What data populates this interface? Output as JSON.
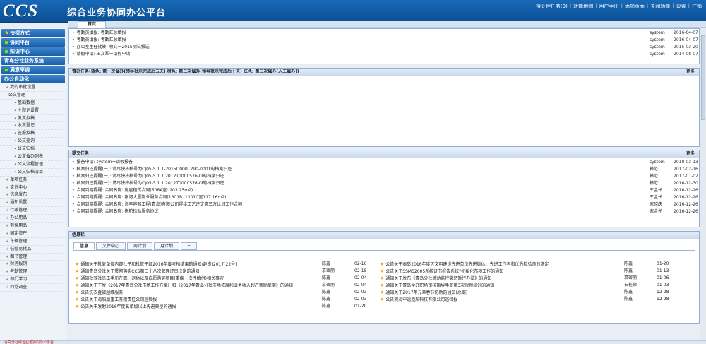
{
  "header": {
    "logo": "CCS",
    "title": "综合业务协同办公平台",
    "links": [
      "待处理任务(9)",
      "功能地图",
      "用户手册",
      "添加页面",
      "关闭功能",
      "设置",
      "注销"
    ]
  },
  "tabs": {
    "home": "首页"
  },
  "sidebar": {
    "sections_top": [
      "快捷方式",
      "协同平台",
      "知识中心",
      "青岛分社业务系统",
      "满意率调"
    ],
    "office_title": "办公自动化",
    "items": [
      {
        "label": "我的审批设置",
        "level": 0,
        "marker": "+"
      },
      {
        "label": "公文管理",
        "level": 0,
        "marker": "-"
      },
      {
        "label": "基础数据",
        "level": 1,
        "marker": "•"
      },
      {
        "label": "主题词设置",
        "level": 1,
        "marker": "•"
      },
      {
        "label": "发文拟稿",
        "level": 1,
        "marker": "•"
      },
      {
        "label": "收文登记",
        "level": 1,
        "marker": "•"
      },
      {
        "label": "签报拟稿",
        "level": 1,
        "marker": "•"
      },
      {
        "label": "公文查询",
        "level": 1,
        "marker": "•"
      },
      {
        "label": "公文归档",
        "level": 1,
        "marker": "•"
      },
      {
        "label": "公文催办列表",
        "level": 1,
        "marker": "•"
      },
      {
        "label": "公文流程管理",
        "level": 1,
        "marker": "•"
      },
      {
        "label": "公文归档清单",
        "level": 1,
        "marker": "•"
      },
      {
        "label": "单项任务",
        "level": 0,
        "marker": "+"
      },
      {
        "label": "文件中心",
        "level": 0,
        "marker": "+"
      },
      {
        "label": "信息发布",
        "level": 0,
        "marker": "+"
      },
      {
        "label": "通知设置",
        "level": 0,
        "marker": "+"
      },
      {
        "label": "行政管理",
        "level": 0,
        "marker": "+"
      },
      {
        "label": "办公用品",
        "level": 0,
        "marker": "+"
      },
      {
        "label": "劳保用品",
        "level": 0,
        "marker": "+"
      },
      {
        "label": "固定资产",
        "level": 0,
        "marker": "+"
      },
      {
        "label": "车辆管理",
        "level": 0,
        "marker": "+"
      },
      {
        "label": "低值易耗品",
        "level": 0,
        "marker": "+"
      },
      {
        "label": "图书管理",
        "level": 0,
        "marker": "+"
      },
      {
        "label": "财务报销",
        "level": 0,
        "marker": "+"
      },
      {
        "label": "考勤管理",
        "level": 0,
        "marker": "+"
      },
      {
        "label": "部门学习",
        "level": 0,
        "marker": "+"
      },
      {
        "label": "问卷调查",
        "level": 0,
        "marker": "+"
      }
    ]
  },
  "top_list": {
    "rows": [
      {
        "text": "考勤员填报: 考勤汇总填报",
        "who": "system",
        "when": "2016-04-07"
      },
      {
        "text": "考勤员填报: 考勤汇总填报",
        "who": "system",
        "when": "2016-04-07"
      },
      {
        "text": "办公室主任批转: 收文一2015测试报送",
        "who": "system",
        "when": "2015-03-20"
      },
      {
        "text": "请假申请: 王文军一请假申请",
        "who": "system",
        "when": "2014-08-07"
      }
    ]
  },
  "supervise": {
    "title": "督办任务(蓝色: 第一次催办(领导批示完成后五天) 橙色: 第二次催办(领导批示完成后十天) 红色: 第三次催办(人工催办))",
    "more": "更多"
  },
  "todo": {
    "title": "提交任务",
    "more": "更多",
    "rows": [
      {
        "text": "报备申请: system一请假报备",
        "who": "system",
        "when": "2018-03-13"
      },
      {
        "text": "档案归还提醒(一): 请尽快将档号为CJ05-5.1.1-2015D0001290-0001的档案归还",
        "who": "韩范",
        "when": "2017-02-16"
      },
      {
        "text": "档案归还提醒(一): 请尽快将档号为CJ05-5.1.1.2012T0000576-0l的档案归还",
        "who": "韩范",
        "when": "2017-01-02"
      },
      {
        "text": "档案归还提醒(一): 请尽快将档号为CJ05-5.1.1.2012T0000576-0l的档案归还",
        "who": "韩范",
        "when": "2016-12-30"
      },
      {
        "text": "合同到期提醒: 合同名称: 房屋租赁合同(506A室: 203.25m2)",
        "who": "王金长",
        "when": "2016-12-26"
      },
      {
        "text": "合同到期提醒: 合同名称: 银河大厦物业服务合同(1301B, 1301C室117.16m2)",
        "who": "王金长",
        "when": "2016-12-26"
      },
      {
        "text": "合同到期提醒: 合同名称: 海丰容器工程(青岛)有限公司焊接工艺评定第三方认证工作合同",
        "who": "宋晓庆",
        "when": "2016-12-26"
      },
      {
        "text": "合同到期提醒: 合同名称: 拖航检验服务协议",
        "who": "宋金光",
        "when": "2016-12-26"
      }
    ]
  },
  "info": {
    "title": "信息栏",
    "tabs": [
      "信息",
      "文件中心",
      "周计划",
      "月计划",
      "+"
    ],
    "left": [
      {
        "text": "通知关于批复单位内部社子和社管干部2016年度考核结果的通知/赵资(2017)22号)",
        "who": "陈鑫",
        "when": "02-16"
      },
      {
        "text": "通知青岛分社关于贯彻落实CCS第三十八次管理评审决定的通知",
        "who": "慕密丽",
        "when": "02-15"
      },
      {
        "text": "通知批驳社员工手册在职、退休以及自愿购买项目(重疾一次性给付)相关事宜",
        "who": "陈鑫",
        "when": "02-04"
      },
      {
        "text": "通知关于下发《2017年青岛分社市场工作方案》和《2017年青岛分社市场拓展和业务收入超产奖励草案》的通知",
        "who": "慕密丽",
        "when": "02-04"
      },
      {
        "text": "公告洗衣叠被超级服务",
        "who": "陈鑫",
        "when": "02-03"
      },
      {
        "text": "公告关于海船舶重工有限责任公司巡检报",
        "who": "陈鑫",
        "when": "02-03"
      },
      {
        "text": "公告关于发射2016年度名单级以上先进典型的通报",
        "who": "陈鑫",
        "when": "01-20"
      }
    ],
    "right": [
      {
        "text": "公告关于表彰2016年度区文明建设先进单位先进集体、先进工作者和优秀检验师的决定",
        "who": "陈鑫",
        "when": "01-20"
      },
      {
        "text": "公告关于SSMS2005系统证书报告系统”初始化布项工作的通知",
        "who": "陈鑫",
        "when": "01-13"
      },
      {
        "text": "通知关于发布《青岛分社活动监控奖惩暂行办法》的通知",
        "who": "慕密丽",
        "when": "01-06"
      },
      {
        "text": "通知关于青岛举办职场审核指导手册第3次视频培训的通知",
        "who": "石桂荣",
        "when": "01-03"
      },
      {
        "text": "通知关于2017年元旦春节协助的通知(总部)",
        "who": "陈鑫",
        "when": "12-28"
      },
      {
        "text": "公告滨海中远造船科技有限公司巡检报",
        "who": "陈鑫",
        "when": "12-28"
      }
    ]
  },
  "footer": {
    "text": "青岛分社综合业务协同办公平台"
  }
}
